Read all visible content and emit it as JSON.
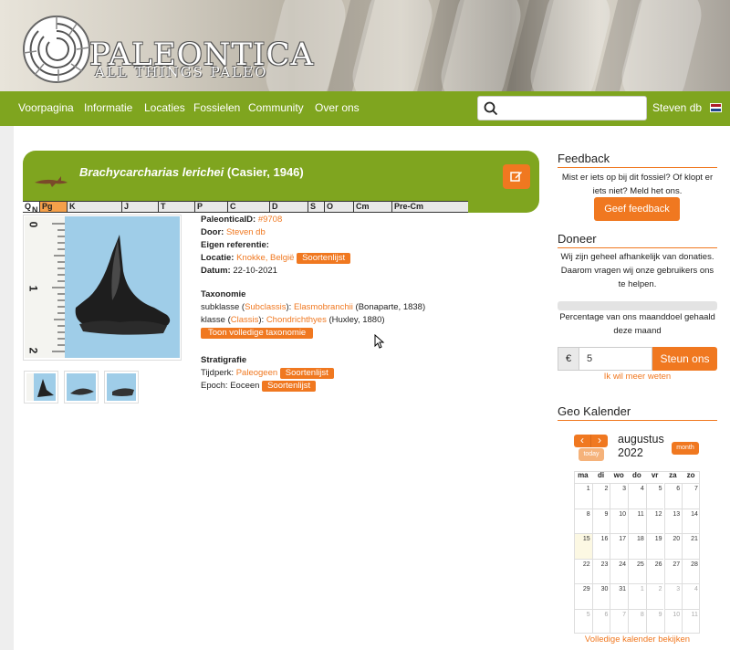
{
  "header": {
    "logo_title": "PALEONTICA",
    "logo_subtitle": "ALL THINGS PALEO"
  },
  "nav": {
    "items": [
      "Voorpagina",
      "Informatie",
      "Locaties",
      "Fossielen",
      "Community",
      "Over ons"
    ],
    "user": "Steven db",
    "search_placeholder": ""
  },
  "fossil": {
    "name": "Brachycarcharias lerichei",
    "author": " (Casier, 1946)",
    "timeline": [
      "Q",
      "N",
      "Pg",
      "K",
      "J",
      "T",
      "P",
      "C",
      "D",
      "S",
      "O",
      "Cm",
      "Pre-Cm"
    ],
    "id_label": "PaleonticaID:",
    "id_value": "#9708",
    "door_label": "Door:",
    "door_value": "Steven db",
    "ref_label": "Eigen referentie:",
    "loc_label": "Locatie:",
    "loc_value": "Knokke, België",
    "loc_tag": "Soortenlijst",
    "date_label": "Datum:",
    "date_value": "22-10-2021",
    "tax_heading": "Taxonomie",
    "tax1_prefix": "subklasse (",
    "tax1_rank": "Subclassis",
    "tax1_mid": "): ",
    "tax1_name": "Elasmobranchii",
    "tax1_author": " (Bonaparte, 1838)",
    "tax2_prefix": "klasse (",
    "tax2_rank": "Classis",
    "tax2_mid": "): ",
    "tax2_name": "Chondrichthyes",
    "tax2_author": " (Huxley, 1880)",
    "tax_button": "Toon volledige taxonomie",
    "strat_heading": "Stratigrafie",
    "period_label": "Tijdperk:",
    "period_value": "Paleogeen",
    "period_tag": "Soortenlijst",
    "epoch_label": "Epoch:",
    "epoch_value": "Eoceen",
    "epoch_tag": "Soortenlijst",
    "scale_labels": [
      "0",
      "1",
      "2"
    ]
  },
  "sidebar": {
    "feedback_title": "Feedback",
    "feedback_text": "Mist er iets op bij dit fossiel? Of klopt er iets niet? Meld het ons.",
    "feedback_button": "Geef feedback",
    "donate_title": "Doneer",
    "donate_text": "Wij zijn geheel afhankelijk van donaties. Daarom vragen wij onze gebruikers ons te helpen.",
    "progress_text": "Percentage van ons maanddoel gehaald deze maand",
    "progress_value": 0,
    "currency": "€",
    "amount": "5",
    "donate_button": "Steun ons",
    "more_link": "Ik wil meer weten",
    "cal_title": "Geo Kalender",
    "cal_month": "augustus",
    "cal_year": "2022",
    "cal_today": "today",
    "cal_view": "month",
    "cal_prev": "‹",
    "cal_next": "›",
    "cal_days": [
      "ma",
      "di",
      "wo",
      "do",
      "vr",
      "za",
      "zo"
    ],
    "cal_weeks": [
      [
        "1",
        "2",
        "3",
        "4",
        "5",
        "6",
        "7"
      ],
      [
        "8",
        "9",
        "10",
        "11",
        "12",
        "13",
        "14"
      ],
      [
        "15",
        "16",
        "17",
        "18",
        "19",
        "20",
        "21"
      ],
      [
        "22",
        "23",
        "24",
        "25",
        "26",
        "27",
        "28"
      ],
      [
        "29",
        "30",
        "31",
        "1",
        "2",
        "3",
        "4"
      ],
      [
        "5",
        "6",
        "7",
        "8",
        "9",
        "10",
        "11"
      ]
    ],
    "cal_link": "Volledige kalender bekijken"
  },
  "colors": {
    "green": "#7fa51f",
    "orange": "#f07820"
  }
}
